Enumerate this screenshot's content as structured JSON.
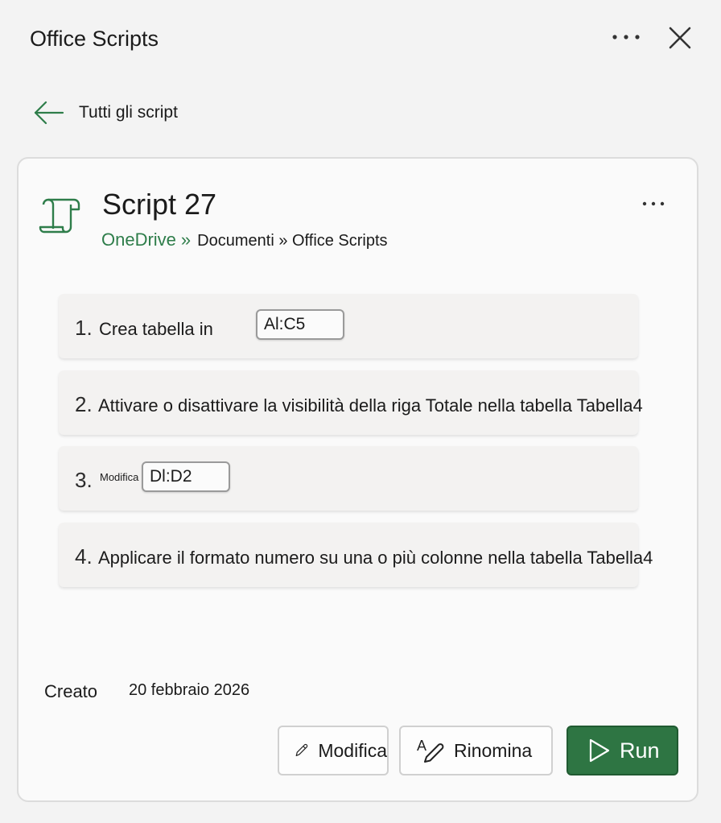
{
  "header": {
    "title": "Office Scripts"
  },
  "nav": {
    "back_label": "Tutti gli script"
  },
  "script": {
    "name": "Script 27",
    "path_root": "OneDrive",
    "path_separator": "»",
    "path_rest": "Documenti » Office Scripts",
    "steps": [
      {
        "number": "1.",
        "text": "Crea tabella in",
        "range": "Al:C5"
      },
      {
        "number": "2.",
        "text": "Attivare o disattivare la visibilità della riga Totale nella tabella Tabella4"
      },
      {
        "number": "3.",
        "text": "Modifica",
        "range": "Dl:D2"
      },
      {
        "number": "4.",
        "text": "Applicare il formato numero su una o più colonne nella tabella Tabella4"
      }
    ],
    "created_label": "Creato",
    "created_date": "20 febbraio 2026"
  },
  "actions": {
    "edit_label": "Modifica",
    "rename_label": "Rinomina",
    "run_label": "Run"
  },
  "colors": {
    "accent_green": "#2e7543",
    "link_green": "#2e7d4a",
    "background": "#f3f3f3"
  },
  "icons": {
    "more": "more-horizontal-icon",
    "close": "close-icon",
    "back": "arrow-left-icon",
    "script": "script-scroll-icon",
    "edit": "pencil-icon",
    "rename": "rename-icon",
    "run": "play-icon"
  }
}
